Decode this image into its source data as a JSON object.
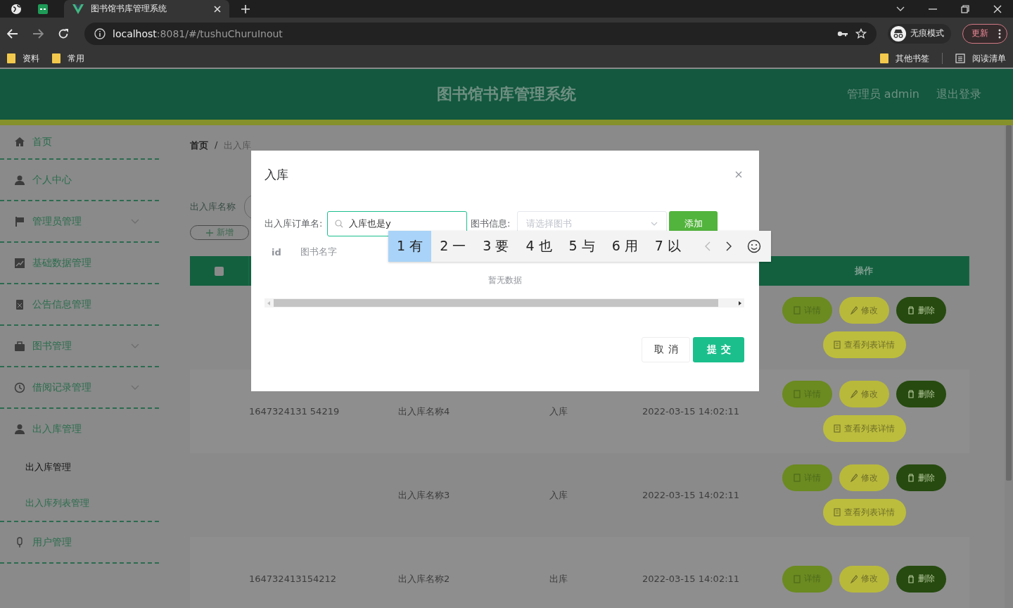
{
  "browser": {
    "tabs": [
      {
        "title": "图书馆书库管理系统",
        "selected": true
      }
    ],
    "address": {
      "host": "localhost",
      "path": ":8081/#/tushuChuruInout"
    },
    "profile": {
      "label": "无痕模式"
    },
    "update_button": "更新",
    "bookmarks": [
      {
        "label": "资料",
        "kind": "folder"
      },
      {
        "label": "常用",
        "kind": "folder"
      }
    ],
    "bookmarks_right": [
      {
        "label": "其他书签",
        "kind": "folder"
      },
      {
        "label": "阅读清单",
        "kind": "list"
      }
    ]
  },
  "app": {
    "header": {
      "title": "图书馆书库管理系统",
      "user": "管理员 admin",
      "logout": "退出登录"
    },
    "sidebar": {
      "items": [
        {
          "label": "首页",
          "chevron": false
        },
        {
          "label": "个人中心",
          "chevron": false
        },
        {
          "label": "管理员管理",
          "chevron": true
        },
        {
          "label": "基础数据管理",
          "chevron": false
        },
        {
          "label": "公告信息管理",
          "chevron": false
        },
        {
          "label": "图书管理",
          "chevron": true
        },
        {
          "label": "借阅记录管理",
          "chevron": true
        },
        {
          "label": "出入库管理",
          "chevron": false,
          "children": [
            {
              "label": "出入库管理",
              "selected": true
            },
            {
              "label": "出入库列表管理",
              "selected": false
            }
          ]
        },
        {
          "label": "用户管理",
          "chevron": false
        }
      ]
    },
    "breadcrumb": {
      "items": [
        "首页",
        "出入库"
      ],
      "separator": "/"
    },
    "search": {
      "label": "出入库名称"
    },
    "add_button": "新增",
    "table": {
      "select_all": {
        "checked": false
      },
      "action_column": "操作",
      "rows": [
        {
          "actions": [
            {
              "kind": "detail",
              "label": "详情"
            },
            {
              "kind": "edit",
              "label": "修改"
            },
            {
              "kind": "delete",
              "label": "删除"
            },
            {
              "kind": "list",
              "label": "查看列表详情"
            }
          ]
        },
        {
          "id": "1647324131 54219",
          "name": "出入库名称4",
          "type": "入库",
          "time": "2022-03-15 14:02:11",
          "actions": [
            {
              "kind": "detail",
              "label": "详情"
            },
            {
              "kind": "edit",
              "label": "修改"
            },
            {
              "kind": "delete",
              "label": "删除"
            },
            {
              "kind": "list",
              "label": "查看列表详情"
            }
          ]
        },
        {
          "name": "出入库名称3",
          "type": "入库",
          "time": "2022-03-15 14:02:11",
          "actions": [
            {
              "kind": "detail",
              "label": "详情"
            },
            {
              "kind": "edit",
              "label": "修改"
            },
            {
              "kind": "delete",
              "label": "删除"
            },
            {
              "kind": "list",
              "label": "查看列表详情"
            }
          ]
        },
        {
          "id": "164732413154212",
          "name": "出入库名称2",
          "type": "出库",
          "time": "2022-03-15 14:02:11",
          "actions": [
            {
              "kind": "detail",
              "label": "详情"
            },
            {
              "kind": "edit",
              "label": "修改"
            },
            {
              "kind": "delete",
              "label": "删除"
            }
          ]
        }
      ]
    }
  },
  "dialog": {
    "title": "入库",
    "form": {
      "order_label": "出入库订单名:",
      "order_value": "入库也是y",
      "book_label": "图书信息:",
      "book_placeholder": "请选择图书",
      "add_button": "添加"
    },
    "table": {
      "columns": [
        "id",
        "图书名字"
      ],
      "empty_text": "暂无数据"
    },
    "buttons": [
      {
        "kind": "cancel",
        "label": "取消"
      },
      {
        "kind": "submit",
        "label": "提交"
      }
    ]
  },
  "ime": {
    "candidates": [
      {
        "label": "1 有",
        "selected": true
      },
      {
        "label": "2 一",
        "selected": false
      },
      {
        "label": "3 要",
        "selected": false
      },
      {
        "label": "4 也",
        "selected": false
      },
      {
        "label": "5 与",
        "selected": false
      },
      {
        "label": "6 用",
        "selected": false
      },
      {
        "label": "7 以",
        "selected": false
      }
    ],
    "prev_disabled": true,
    "next_disabled": false
  }
}
